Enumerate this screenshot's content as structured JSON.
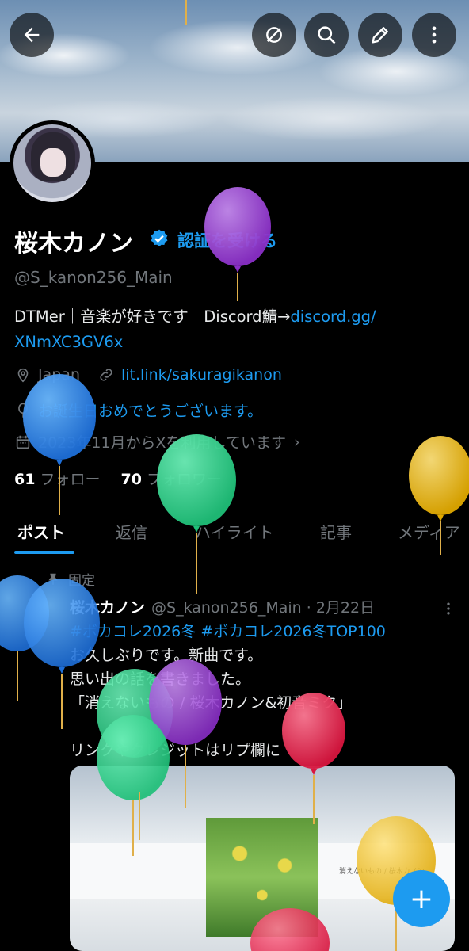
{
  "profile": {
    "name": "桜木カノン",
    "verify_label": "認証を受ける",
    "handle": "@S_kanon256_Main",
    "bio_text": "DTMer｜音楽が好きです｜Discord鯖→",
    "bio_link_1": "discord.gg/",
    "bio_link_2": "XNmXC3GV6x",
    "location": "Japan",
    "website": "lit.link/sakuragikanon",
    "birthday": "お誕生日おめでとうございます。",
    "joined": "2023年11月からXを利用しています",
    "following_count": "61",
    "following_label": "フォロー",
    "followers_count": "70",
    "followers_label": "フォロワー"
  },
  "tabs": [
    "ポスト",
    "返信",
    "ハイライト",
    "記事",
    "メディア"
  ],
  "post": {
    "pinned_label": "固定",
    "author": "桜木カノン",
    "meta": "@S_kanon256_Main · 2月22日",
    "tags": "#ボカコレ2026冬 #ボカコレ2026冬TOP100",
    "body": "お久しぶりです。新曲です。\n思い出の話を書きました。\n「消えないもの / 桜木カノン&初音ミク」\n\nリンクやクレジットはリプ欄に",
    "media_caption": "消えないもの / 桜木カノン"
  },
  "fab_label": "+",
  "colors": {
    "accent": "#1d9bf0",
    "muted": "#71767b",
    "background": "#000000"
  },
  "icons": [
    "back-arrow-icon",
    "no-translate-icon",
    "search-icon",
    "edit-icon",
    "more-vertical-icon",
    "verified-badge-icon",
    "location-icon",
    "link-icon",
    "balloon-icon",
    "calendar-icon",
    "pin-icon"
  ]
}
